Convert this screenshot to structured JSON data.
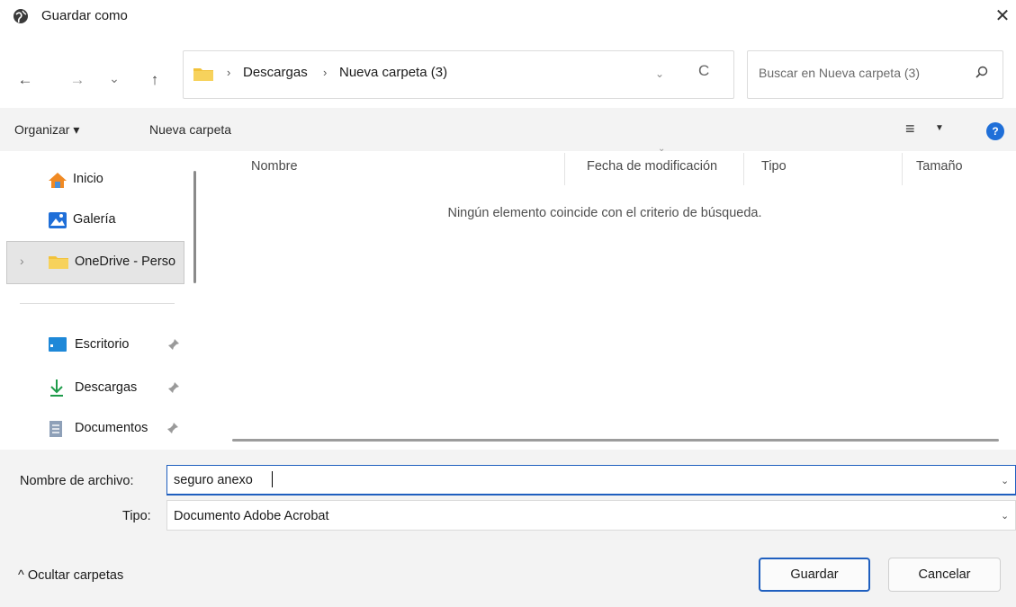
{
  "window": {
    "title": "Guardar como",
    "close_glyph": "✕",
    "icon": "globe-icon"
  },
  "nav": {
    "back_glyph": "←",
    "forward_glyph": "→",
    "recent_glyph": "⌄",
    "up_glyph": "↑",
    "address": {
      "separator": "›",
      "crumbs": [
        "Descargas",
        "Nueva carpeta (3)"
      ],
      "dropdown_glyph": "⌄",
      "refresh_glyph": "C"
    },
    "search": {
      "placeholder": "Buscar en Nueva carpeta (3)"
    }
  },
  "toolbar": {
    "organize_label": "Organizar ▾",
    "new_folder_label": "Nueva carpeta",
    "view_glyph": "≡",
    "view_drop_glyph": "▼",
    "help_glyph": "?"
  },
  "sidebar": {
    "items": [
      {
        "label": "Inicio",
        "icon": "home-icon"
      },
      {
        "label": "Galería",
        "icon": "gallery-icon"
      },
      {
        "label": "OneDrive - Perso",
        "icon": "folder-icon",
        "expand_glyph": "›"
      },
      {
        "label": "Escritorio",
        "icon": "desktop-icon",
        "pin_glyph": "📌"
      },
      {
        "label": "Descargas",
        "icon": "download-icon",
        "pin_glyph": "📌"
      },
      {
        "label": "Documentos",
        "icon": "document-icon",
        "pin_glyph": "📌"
      }
    ]
  },
  "content": {
    "columns": [
      "Nombre",
      "Fecha de modificación",
      "Tipo",
      "Tamaño"
    ],
    "sort_caret": "⌄",
    "empty_message": "Ningún elemento coincide con el criterio de búsqueda."
  },
  "fields": {
    "filename_label": "Nombre de archivo:",
    "filename_value": "seguro anexo",
    "type_label": "Tipo:",
    "type_value": "Documento Adobe Acrobat",
    "dropdown_glyph": "⌄"
  },
  "footer": {
    "hide_folders_label": "^  Ocultar carpetas",
    "save_label": "Guardar",
    "cancel_label": "Cancelar"
  },
  "colors": {
    "accent": "#1f5fbf",
    "help_blue": "#1f6fd8",
    "toolbar_bg": "#f3f3f3",
    "folder_yellow": "#f2c23a"
  }
}
